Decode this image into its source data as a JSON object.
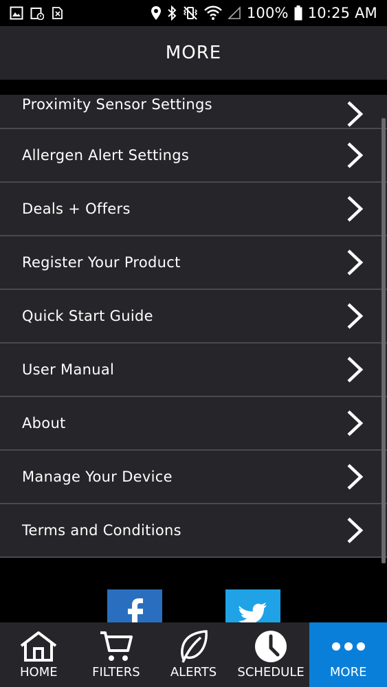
{
  "status_bar": {
    "battery_percent": "100%",
    "time": "10:25 AM"
  },
  "header": {
    "title": "MORE"
  },
  "menu": {
    "items": [
      {
        "label": "Proximity Sensor Settings"
      },
      {
        "label": "Allergen Alert Settings"
      },
      {
        "label": "Deals + Offers"
      },
      {
        "label": "Register Your Product"
      },
      {
        "label": "Quick Start Guide"
      },
      {
        "label": "User Manual"
      },
      {
        "label": "About"
      },
      {
        "label": "Manage Your Device"
      },
      {
        "label": "Terms and Conditions"
      }
    ]
  },
  "social": {
    "facebook_icon": "facebook-icon",
    "twitter_icon": "twitter-icon"
  },
  "bottom_nav": {
    "items": [
      {
        "label": "HOME",
        "icon": "home-icon"
      },
      {
        "label": "FILTERS",
        "icon": "cart-icon"
      },
      {
        "label": "ALERTS",
        "icon": "leaf-icon"
      },
      {
        "label": "SCHEDULE",
        "icon": "clock-icon"
      },
      {
        "label": "MORE",
        "icon": "more-dots-icon"
      }
    ],
    "active_color": "#0a7fd9"
  },
  "colors": {
    "background": "#000000",
    "surface": "#262529",
    "divider": "#4a4a4e",
    "accent": "#0a7fd9"
  }
}
